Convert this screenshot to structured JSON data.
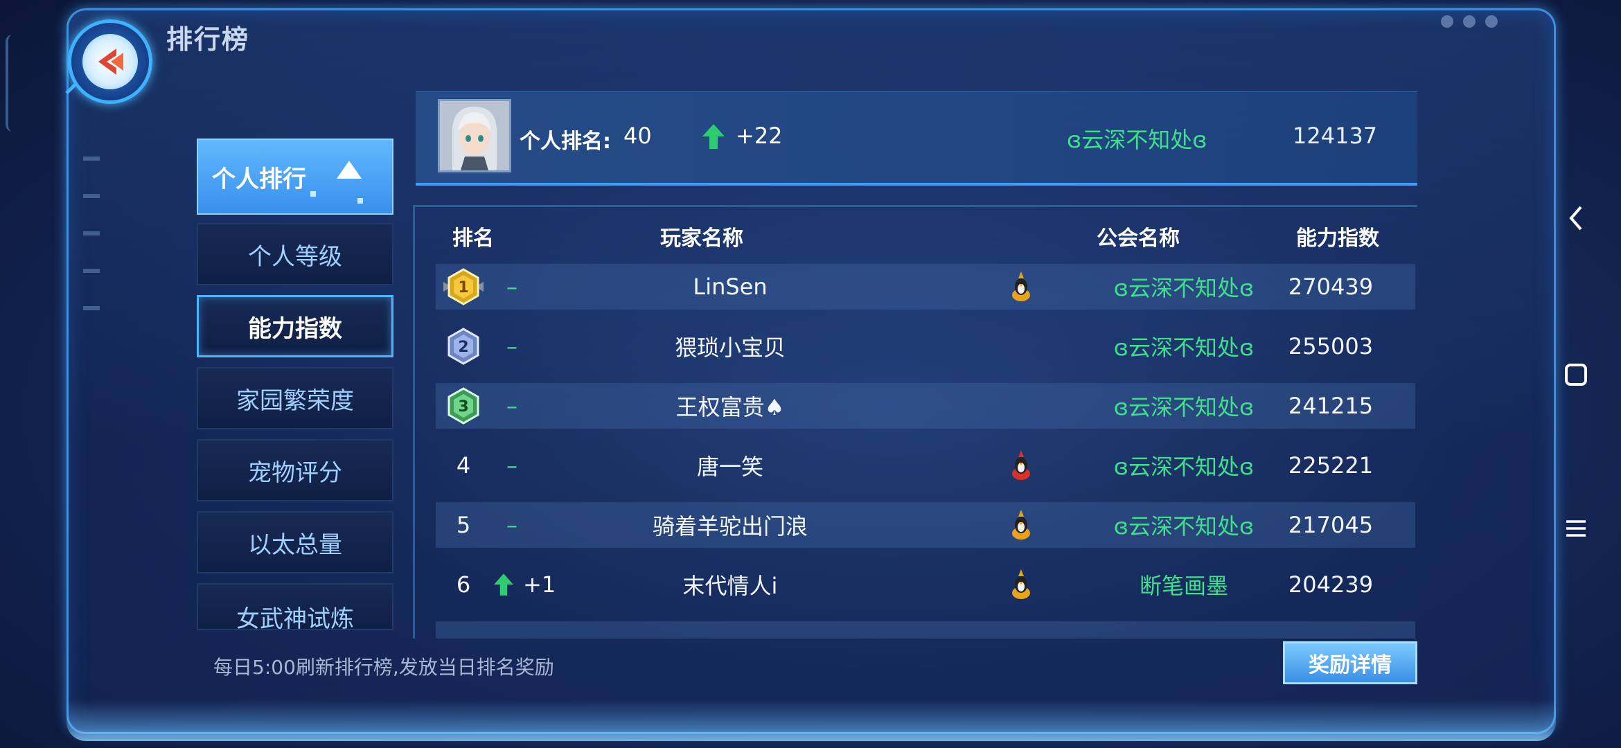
{
  "header": {
    "title": "排行榜"
  },
  "menu": {
    "items": [
      {
        "label": "个人排行"
      },
      {
        "label": "个人等级"
      },
      {
        "label": "能力指数"
      },
      {
        "label": "家园繁荣度"
      },
      {
        "label": "宠物评分"
      },
      {
        "label": "以太总量"
      },
      {
        "label": "女武神试炼"
      }
    ]
  },
  "my_rank": {
    "label": "个人排名:",
    "rank": "40",
    "change": "+22",
    "guild": "ɞ云深不知处ɞ",
    "power": "124137"
  },
  "table": {
    "headers": {
      "rank": "排名",
      "player": "玩家名称",
      "guild": "公会名称",
      "power": "能力指数"
    },
    "rows": [
      {
        "rank": "1",
        "change": "–",
        "player": "LinSen",
        "guild": "ɞ云深不知处ɞ",
        "power": "270439",
        "badge": "penguin-yellow"
      },
      {
        "rank": "2",
        "change": "–",
        "player": "猥琐小宝贝",
        "guild": "ɞ云深不知处ɞ",
        "power": "255003",
        "badge": ""
      },
      {
        "rank": "3",
        "change": "–",
        "player": "王权富贵♠",
        "guild": "ɞ云深不知处ɞ",
        "power": "241215",
        "badge": ""
      },
      {
        "rank": "4",
        "change": "–",
        "player": "唐一笑",
        "guild": "ɞ云深不知处ɞ",
        "power": "225221",
        "badge": "penguin-red"
      },
      {
        "rank": "5",
        "change": "–",
        "player": "骑着羊驼出门浪",
        "guild": "ɞ云深不知处ɞ",
        "power": "217045",
        "badge": "penguin-yellow"
      },
      {
        "rank": "6",
        "change": "+1",
        "player": "末代情人i",
        "guild": "断笔画墨",
        "power": "204239",
        "badge": "penguin-yellow"
      }
    ]
  },
  "footer": {
    "note": "每日5:00刷新排行榜,发放当日排名奖励",
    "reward_button": "奖励详情"
  },
  "colors": {
    "accent": "#3aa0ff",
    "guild": "#3fe08c",
    "up_arrow": "#2ecc71"
  }
}
